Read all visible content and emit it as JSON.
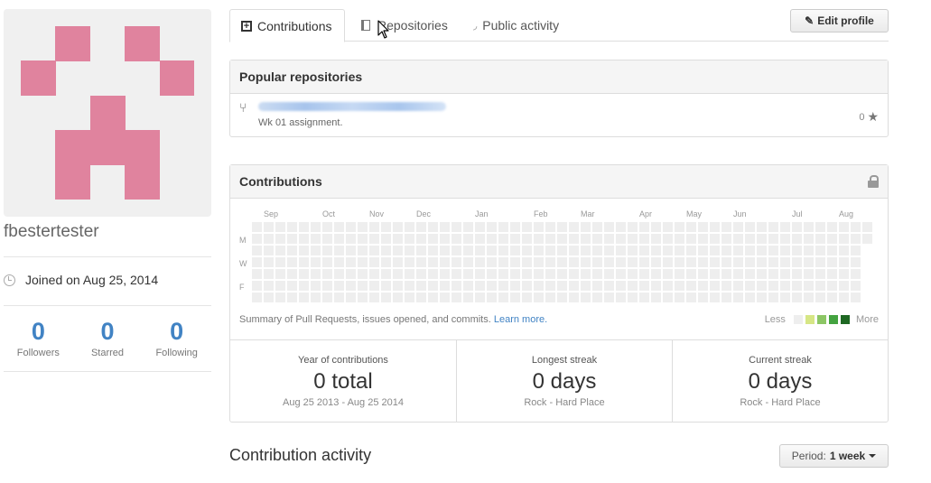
{
  "profile": {
    "username": "fbestertester",
    "joined": "Joined on Aug 25, 2014",
    "avatar_color": "#e0839e",
    "stats": [
      {
        "value": "0",
        "label": "Followers"
      },
      {
        "value": "0",
        "label": "Starred"
      },
      {
        "value": "0",
        "label": "Following"
      }
    ]
  },
  "tabs": [
    {
      "label": "Contributions",
      "icon": "plus-box-icon",
      "active": true
    },
    {
      "label": "Repositories",
      "icon": "book-icon",
      "active": false
    },
    {
      "label": "Public activity",
      "icon": "rss-icon",
      "active": false
    }
  ],
  "edit_profile": {
    "label": "Edit profile",
    "icon": "pencil-icon"
  },
  "popular_repos": {
    "title": "Popular repositories",
    "items": [
      {
        "name_redacted": true,
        "description": "Wk 01 assignment.",
        "stars": "0",
        "icon": "fork-icon"
      }
    ]
  },
  "contributions": {
    "title": "Contributions",
    "lock_icon": "lock-icon",
    "months": [
      "Sep",
      "Oct",
      "Nov",
      "Dec",
      "Jan",
      "Feb",
      "Mar",
      "Apr",
      "May",
      "Jun",
      "Jul",
      "Aug"
    ],
    "days": [
      "M",
      "W",
      "F"
    ],
    "summary": "Summary of Pull Requests, issues opened, and commits.",
    "learn_more": "Learn more.",
    "legend_less": "Less",
    "legend_more": "More",
    "legend_colors": [
      "#eeeeee",
      "#d6e685",
      "#8cc665",
      "#44a340",
      "#1e6823"
    ],
    "empty_color": "#eeeeee",
    "stats": [
      {
        "title": "Year of contributions",
        "value": "0 total",
        "range": "Aug 25 2013 - Aug 25 2014"
      },
      {
        "title": "Longest streak",
        "value": "0 days",
        "range": "Rock - Hard Place"
      },
      {
        "title": "Current streak",
        "value": "0 days",
        "range": "Rock - Hard Place"
      }
    ]
  },
  "activity": {
    "title": "Contribution activity",
    "period_label": "Period:",
    "period_value": "1 week"
  }
}
